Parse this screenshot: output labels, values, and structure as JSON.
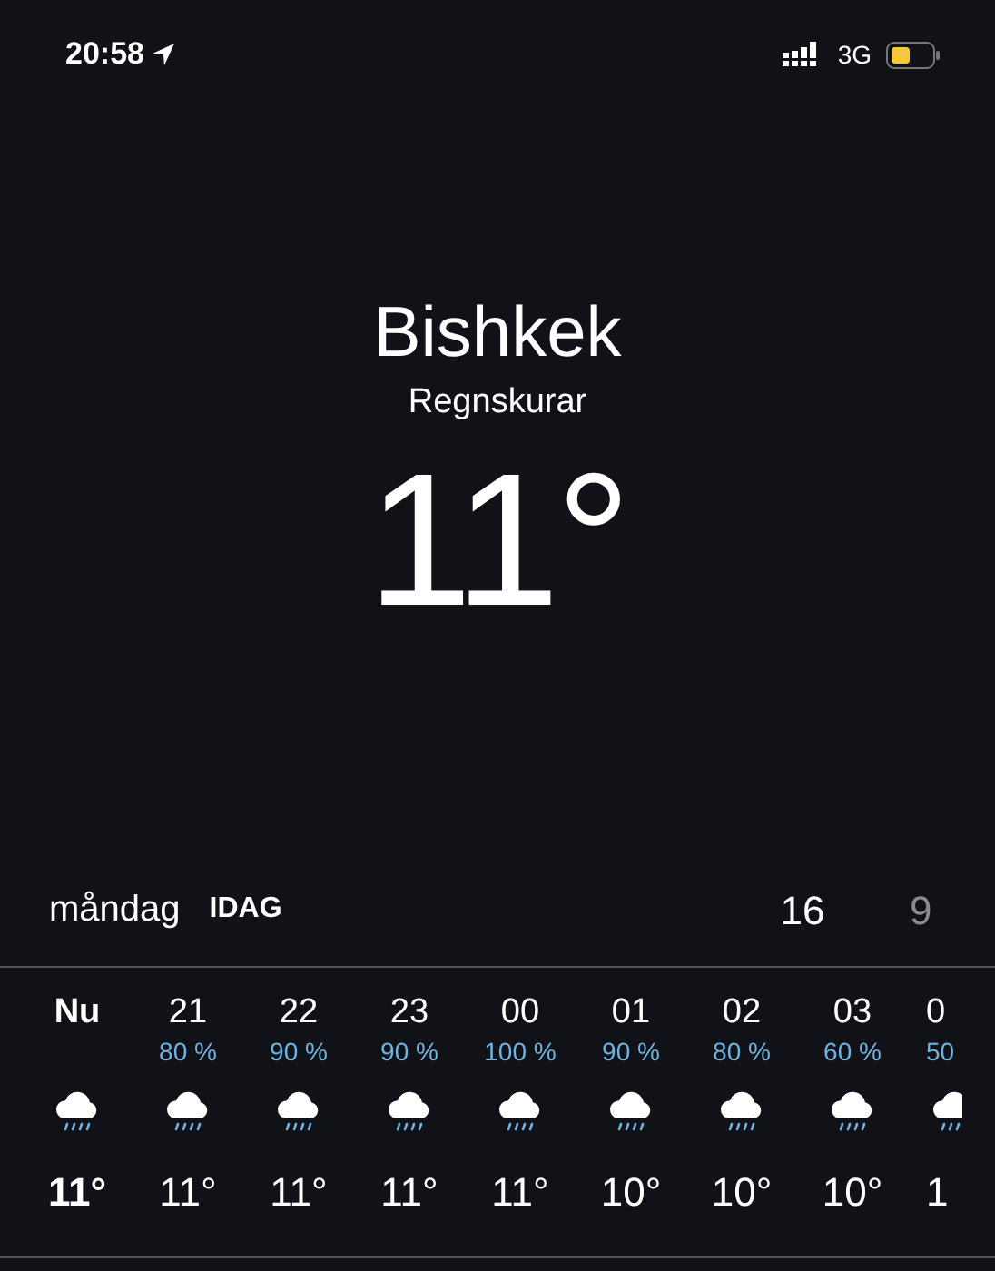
{
  "status_bar": {
    "time": "20:58",
    "network": "3G"
  },
  "location": {
    "city": "Bishkek",
    "condition": "Regnskurar",
    "temperature": "11°"
  },
  "today": {
    "day": "måndag",
    "label": "IDAG",
    "high": "16",
    "low": "9"
  },
  "hours": [
    {
      "time": "Nu",
      "temp": "11°",
      "current": true
    },
    {
      "time": "21",
      "precip": "80 %",
      "temp": "11°",
      "current": false
    },
    {
      "time": "22",
      "precip": "90 %",
      "temp": "11°",
      "current": false
    },
    {
      "time": "23",
      "precip": "90 %",
      "temp": "11°",
      "current": false
    },
    {
      "time": "00",
      "precip": "100 %",
      "temp": "11°",
      "current": false
    },
    {
      "time": "01",
      "precip": "90 %",
      "temp": "10°",
      "current": false
    },
    {
      "time": "02",
      "precip": "80 %",
      "temp": "10°",
      "current": false
    },
    {
      "time": "03",
      "precip": "60 %",
      "temp": "10°",
      "current": false
    },
    {
      "time": "0",
      "precip": "50",
      "temp": "1",
      "current": false,
      "cut": true
    }
  ]
}
